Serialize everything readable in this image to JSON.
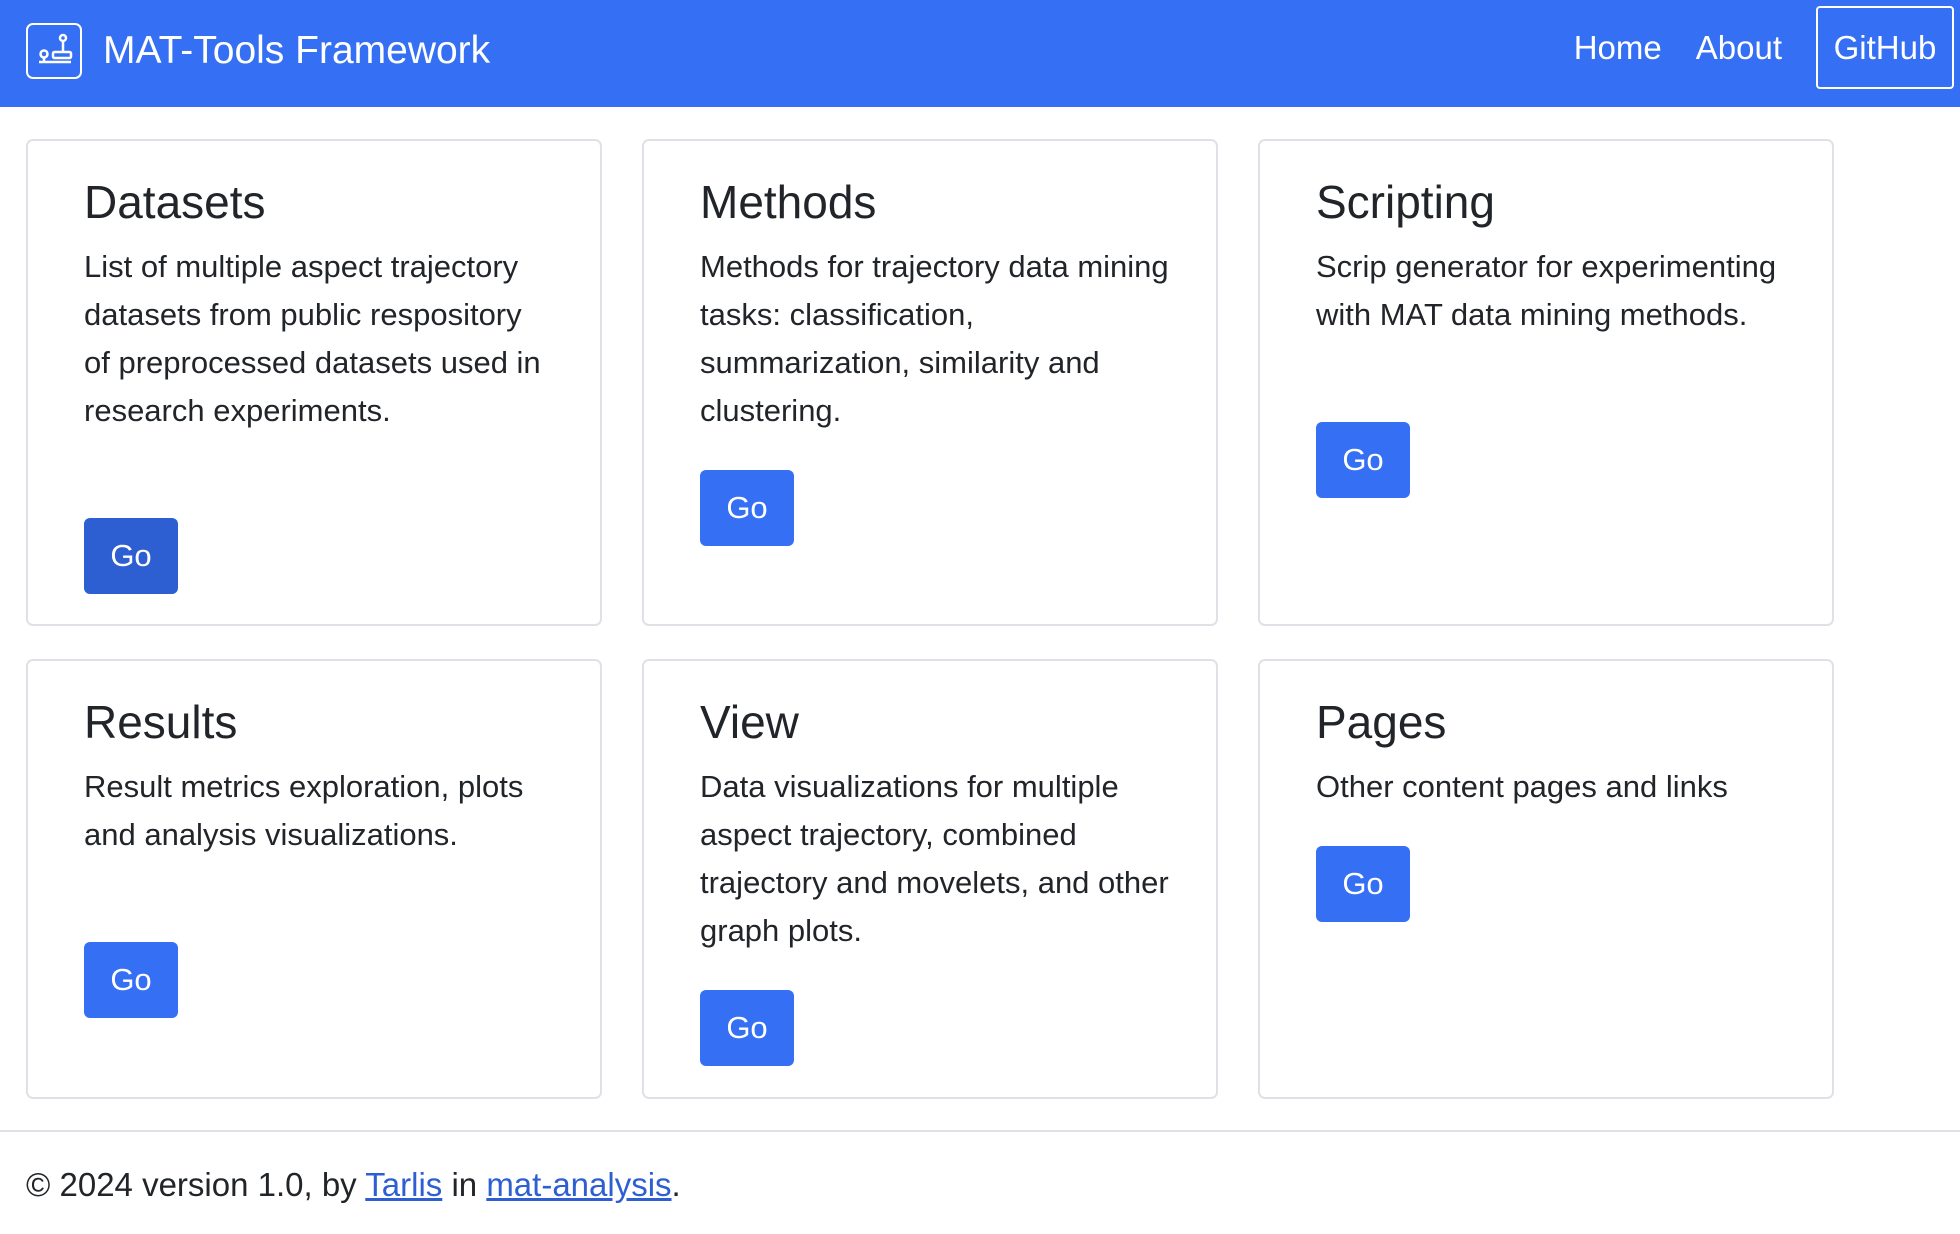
{
  "navbar": {
    "brand": "MAT-Tools Framework",
    "brand_icon": "joystick-icon",
    "links": [
      "Home",
      "About"
    ],
    "github_label": "GitHub"
  },
  "cards": [
    {
      "title": "Datasets",
      "text": "List of multiple aspect trajectory datasets from public respository of preprocessed datasets used in research experiments.",
      "button": "Go"
    },
    {
      "title": "Methods",
      "text": "Methods for trajectory data mining tasks: classification, summarization, similarity and clustering.",
      "button": "Go"
    },
    {
      "title": "Scripting",
      "text": "Scrip generator for experimenting with MAT data mining methods.",
      "button": "Go"
    },
    {
      "title": "Results",
      "text": "Result metrics exploration, plots and analysis visualizations.",
      "button": "Go"
    },
    {
      "title": "View",
      "text": "Data visualizations for multiple aspect trajectory, combined trajectory and movelets, and other graph plots.",
      "button": "Go"
    },
    {
      "title": "Pages",
      "text": "Other content pages and links",
      "button": "Go"
    }
  ],
  "footer": {
    "prefix": "© 2024 version 1.0, by",
    "author": "Tarlis",
    "middle": "in",
    "repo": "mat-analysis",
    "suffix": "."
  },
  "colors": {
    "primary": "#356ff4",
    "primary_pressed": "#2e5fd2",
    "border": "#dee2e6",
    "text": "#212529"
  }
}
